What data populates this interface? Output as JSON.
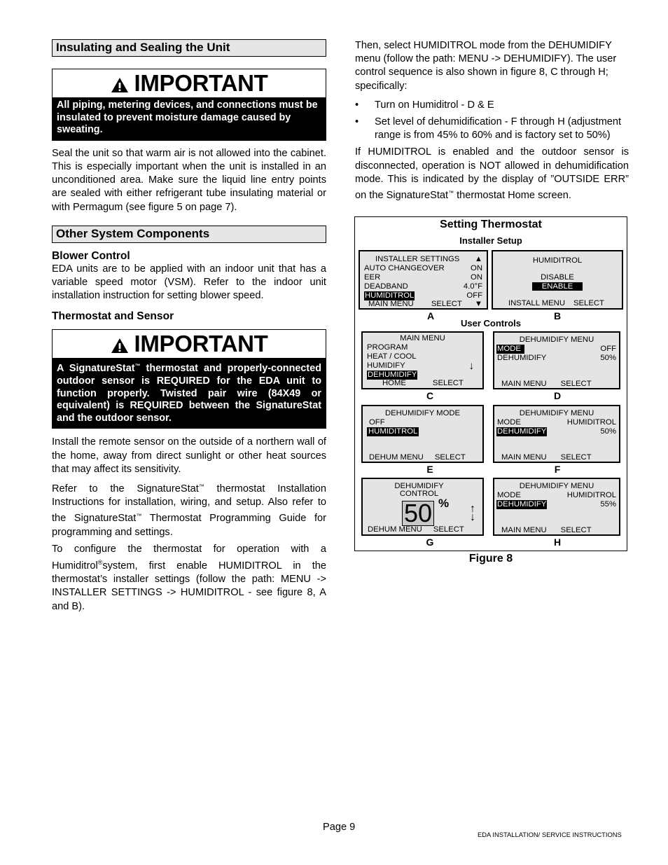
{
  "left_column": {
    "section1_title": "Insulating and Sealing the Unit",
    "important1": {
      "title": "IMPORTANT",
      "icon": "warning-triangle-icon",
      "body": "All piping, metering devices, and connections must be insulated to prevent moisture damage caused by sweating."
    },
    "para1": "Seal the unit so that warm air is not allowed into the cabinet. This is especially important when the unit is installed in an unconditioned area. Make sure the liquid line entry points are sealed with either refrigerant tube insulating material or with Permagum (see figure 5 on page 7).",
    "section2_title": "Other System Components",
    "blower_heading": "Blower Control",
    "blower_text": "EDA units are to be applied with an indoor unit that has a variable speed motor (VSM). Refer to the indoor unit installation instruction for setting blower speed.",
    "thermostat_heading": "Thermostat and Sensor",
    "important2": {
      "title": "IMPORTANT",
      "icon": "warning-triangle-icon",
      "body_a": "A SignatureStat",
      "tm": "™",
      "body_b": " thermostat and properly-connected outdoor sensor is REQUIRED for the EDA unit to function properly. Twisted pair wire (84X49 or equivalent) is REQUIRED between the SignatureStat and the outdoor sensor."
    },
    "para2": "Install the remote sensor on the outside of a northern wall of the home, away from direct sunlight or other heat sources that may affect its sensitivity.",
    "para3_a": "Refer to the SignatureStat",
    "para3_b": " thermostat Installation Instructions for installation, wiring, and setup. Also refer to the SignatureStat",
    "para3_c": " Thermostat Programming Guide for programming and settings.",
    "tm": "™",
    "para4_a": "To configure the thermostat for operation with a Humiditrol",
    "reg": "®",
    "para4_b": "system, first enable HUMIDITROL in the thermostat’s installer settings (follow the path: MENU -> INSTALLER SETTINGS -> HUMIDITROL - see figure 8, A and B)."
  },
  "right_column": {
    "para1": "Then, select HUMIDITROL mode from the DEHUMIDIFY menu (follow the path: MENU -> DEHUMIDIFY). The user control sequence is also shown in figure 8, C through H; specifically:",
    "bullets": [
      "Turn on Humiditrol - D & E",
      "Set level of dehumidification - F through H (adjustment range is from 45% to 60% and is factory set to 50%)"
    ],
    "bullet_glyph": "•",
    "para2_a": "If HUMIDITROL is enabled and the outdoor sensor is disconnected, operation is NOT allowed in dehumidification mode. This is indicated by the display of ”OUTSIDE ERR” on the SignatureStat",
    "tm": "™",
    "para2_b": "  thermostat Home screen."
  },
  "figure": {
    "title": "Setting Thermostat",
    "installer_setup": "Installer Setup",
    "user_controls": "User Controls",
    "caption": "Figure 8",
    "screens": {
      "A": {
        "label": "A",
        "header": "INSTALLER SETTINGS",
        "up_icon": "▲",
        "rows": [
          {
            "name": "AUTO CHANGEOVER",
            "value": "ON"
          },
          {
            "name": "EER",
            "value": "ON"
          },
          {
            "name": "DEADBAND",
            "value": "4.0°F"
          },
          {
            "name": "HUMIDITROL",
            "value": "OFF"
          }
        ],
        "left_soft": "MAIN MENU",
        "right_soft": "SELECT",
        "down_icon": "▼"
      },
      "B": {
        "label": "B",
        "header": "HUMIDITROL",
        "opt1": "DISABLE",
        "opt2": "ENABLE",
        "left_soft": "INSTALL MENU",
        "right_soft": "SELECT"
      },
      "C": {
        "label": "C",
        "header": "MAIN MENU",
        "items": [
          "PROGRAM",
          "HEAT / COOL",
          "HUMIDIFY",
          "DEHUMIDIFY"
        ],
        "arrow": "↓",
        "left_soft": "HOME",
        "right_soft": "SELECT"
      },
      "D": {
        "label": "D",
        "header": "DEHUMIDIFY MENU",
        "rows": [
          {
            "name": "MODE",
            "value": "OFF"
          },
          {
            "name": "DEHUMIDIFY",
            "value": "50%"
          }
        ],
        "left_soft": "MAIN MENU",
        "right_soft": "SELECT"
      },
      "E": {
        "label": "E",
        "header": "DEHUMIDIFY MODE",
        "items": [
          "OFF",
          "HUMIDITROL"
        ],
        "left_soft": "DEHUM MENU",
        "right_soft": "SELECT"
      },
      "F": {
        "label": "F",
        "header": "DEHUMIDIFY MENU",
        "rows": [
          {
            "name": "MODE",
            "value": "HUMIDITROL"
          },
          {
            "name": "DEHUMIDIFY",
            "value": "50%"
          }
        ],
        "left_soft": "MAIN MENU",
        "right_soft": "SELECT"
      },
      "G": {
        "label": "G",
        "header1": "DEHUMIDIFY",
        "header2": "CONTROL",
        "value": "50",
        "unit": "%",
        "up_arrow": "↑",
        "down_arrow": "↓",
        "left_soft": "DEHUM MENU",
        "right_soft": "SELECT"
      },
      "H": {
        "label": "H",
        "header": "DEHUMIDIFY MENU",
        "rows": [
          {
            "name": "MODE",
            "value": "HUMIDITROL"
          },
          {
            "name": "DEHUMIDIFY",
            "value": "55%"
          }
        ],
        "left_soft": "MAIN MENU",
        "right_soft": "SELECT"
      }
    }
  },
  "footer": {
    "page": "Page 9",
    "doc_title": "EDA  INSTALLATION/ SERVICE INSTRUCTIONS"
  }
}
